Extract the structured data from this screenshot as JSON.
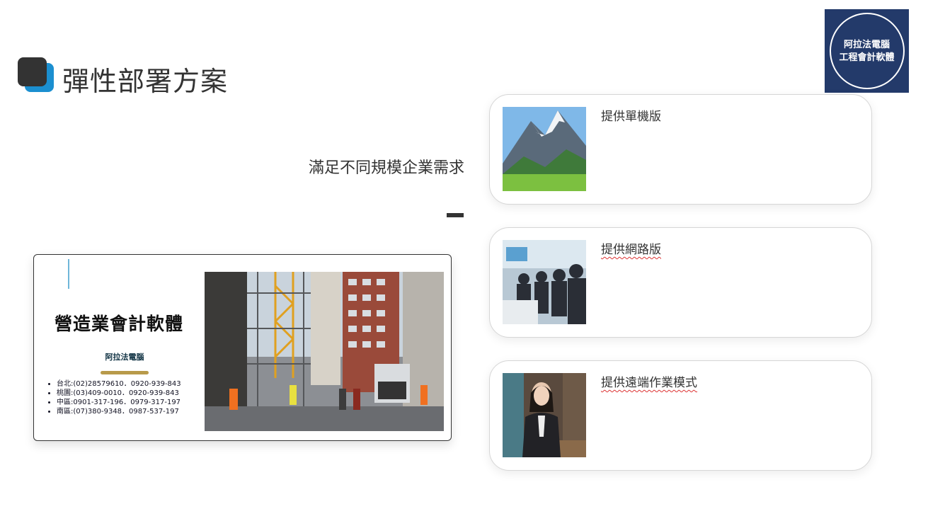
{
  "slide": {
    "title": "彈性部署方案",
    "subtitle": "滿足不同規模企業需求"
  },
  "logo": {
    "line1": "阿拉法電腦",
    "line2": "工程會計軟體",
    "bg_color": "#233a6a"
  },
  "business_card": {
    "product_name": "營造業會計軟體",
    "company": "阿拉法電腦",
    "contacts": [
      "台北:(02)28579610．0920-939-843",
      "桃園:(03)409-0010．0920-939-843",
      "中區:0901-317-196．0979-317-197",
      "南區:(07)380-9348．0987-537-197"
    ],
    "photo": "construction-site-street-photo"
  },
  "features": [
    {
      "label": "提供單機版",
      "thumbnail": "mountain-landscape-photo"
    },
    {
      "label": "提供網路版",
      "thumbnail": "business-meeting-photo"
    },
    {
      "label": "提供遠端作業模式",
      "thumbnail": "businesswoman-portrait-photo"
    }
  ],
  "colors": {
    "accent_blue": "#1b8fd0",
    "dark": "#333333"
  }
}
